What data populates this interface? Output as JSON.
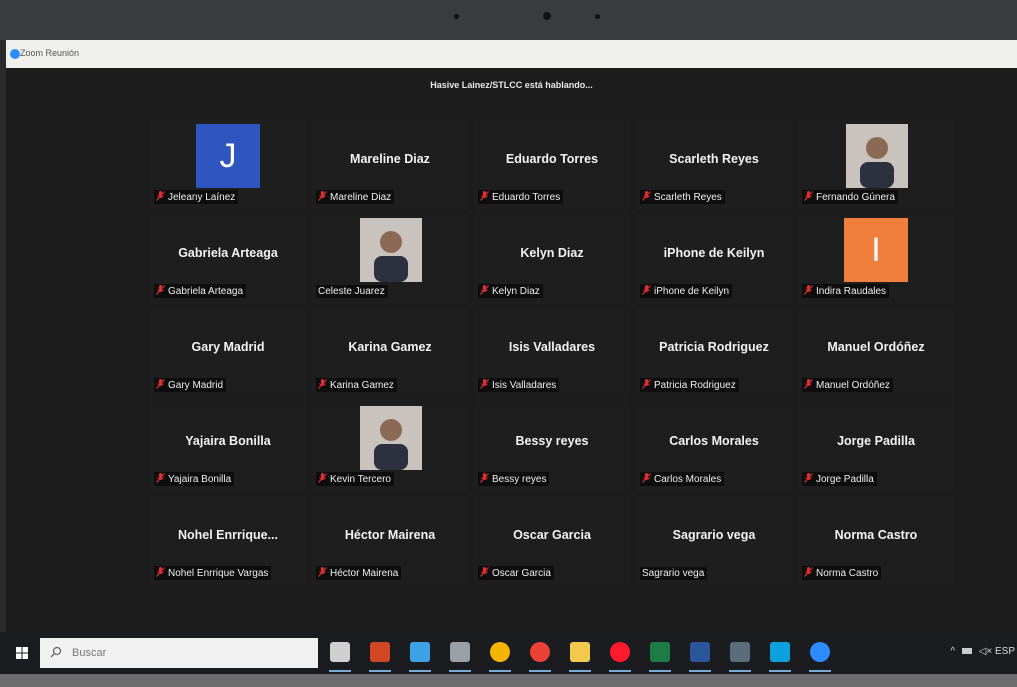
{
  "window": {
    "title": "Zoom Reunión"
  },
  "speaker_banner": "Hasive Lainez/STLCC está hablando...",
  "participants": [
    {
      "big": "",
      "label": "Jeleany Laínez",
      "muted": true,
      "avatar": "letter",
      "letter": "J",
      "color": "#2f55c0"
    },
    {
      "big": "Mareline Diaz",
      "label": "Mareline Diaz",
      "muted": true
    },
    {
      "big": "Eduardo Torres",
      "label": "Eduardo Torres",
      "muted": true
    },
    {
      "big": "Scarleth Reyes",
      "label": "Scarleth Reyes",
      "muted": true
    },
    {
      "big": "",
      "label": "Fernando Gúnera",
      "muted": true,
      "avatar": "photo"
    },
    {
      "big": "Gabriela Arteaga",
      "label": "Gabriela Arteaga",
      "muted": true
    },
    {
      "big": "",
      "label": "Celeste Juarez",
      "muted": false,
      "avatar": "photo"
    },
    {
      "big": "Kelyn Diaz",
      "label": "Kelyn Diaz",
      "muted": true
    },
    {
      "big": "iPhone de Keilyn",
      "label": "iPhone de Keilyn",
      "muted": true
    },
    {
      "big": "",
      "label": "Indira Raudales",
      "muted": true,
      "avatar": "letter",
      "letter": "I",
      "color": "#f07f3c"
    },
    {
      "big": "Gary Madrid",
      "label": "Gary Madrid",
      "muted": true
    },
    {
      "big": "Karina Gamez",
      "label": "Karina Gamez",
      "muted": true
    },
    {
      "big": "Isis Valladares",
      "label": "Isis Valladares",
      "muted": true
    },
    {
      "big": "Patricia Rodriguez",
      "label": "Patricia Rodriguez",
      "muted": true
    },
    {
      "big": "Manuel Ordóñez",
      "label": "Manuel Ordóñez",
      "muted": true
    },
    {
      "big": "Yajaira Bonilla",
      "label": "Yajaira Bonilla",
      "muted": true
    },
    {
      "big": "",
      "label": "Kevin Tercero",
      "muted": true,
      "avatar": "photo"
    },
    {
      "big": "Bessy reyes",
      "label": "Bessy reyes",
      "muted": true
    },
    {
      "big": "Carlos Morales",
      "label": "Carlos Morales",
      "muted": true
    },
    {
      "big": "Jorge Padilla",
      "label": "Jorge Padilla",
      "muted": true
    },
    {
      "big": "Nohel Enrrique...",
      "label": "Nohel Enrrique Vargas",
      "muted": true
    },
    {
      "big": "Héctor Mairena",
      "label": "Héctor Mairena",
      "muted": true
    },
    {
      "big": "Oscar Garcia",
      "label": "Oscar Garcia",
      "muted": true
    },
    {
      "big": "Sagrario vega",
      "label": "Sagrario vega",
      "muted": false
    },
    {
      "big": "Norma Castro",
      "label": "Norma Castro",
      "muted": true
    }
  ],
  "taskbar": {
    "search_placeholder": "Buscar",
    "apps": [
      "task-view",
      "powerpoint",
      "file-explorer",
      "window-app",
      "chrome",
      "chrome-alt",
      "folder",
      "opera",
      "excel",
      "word",
      "calculator",
      "photos",
      "zoom"
    ],
    "tray_text": "ESP"
  },
  "colors": {
    "mic_muted": "#e02f2f",
    "accent": "#2d8cff"
  }
}
